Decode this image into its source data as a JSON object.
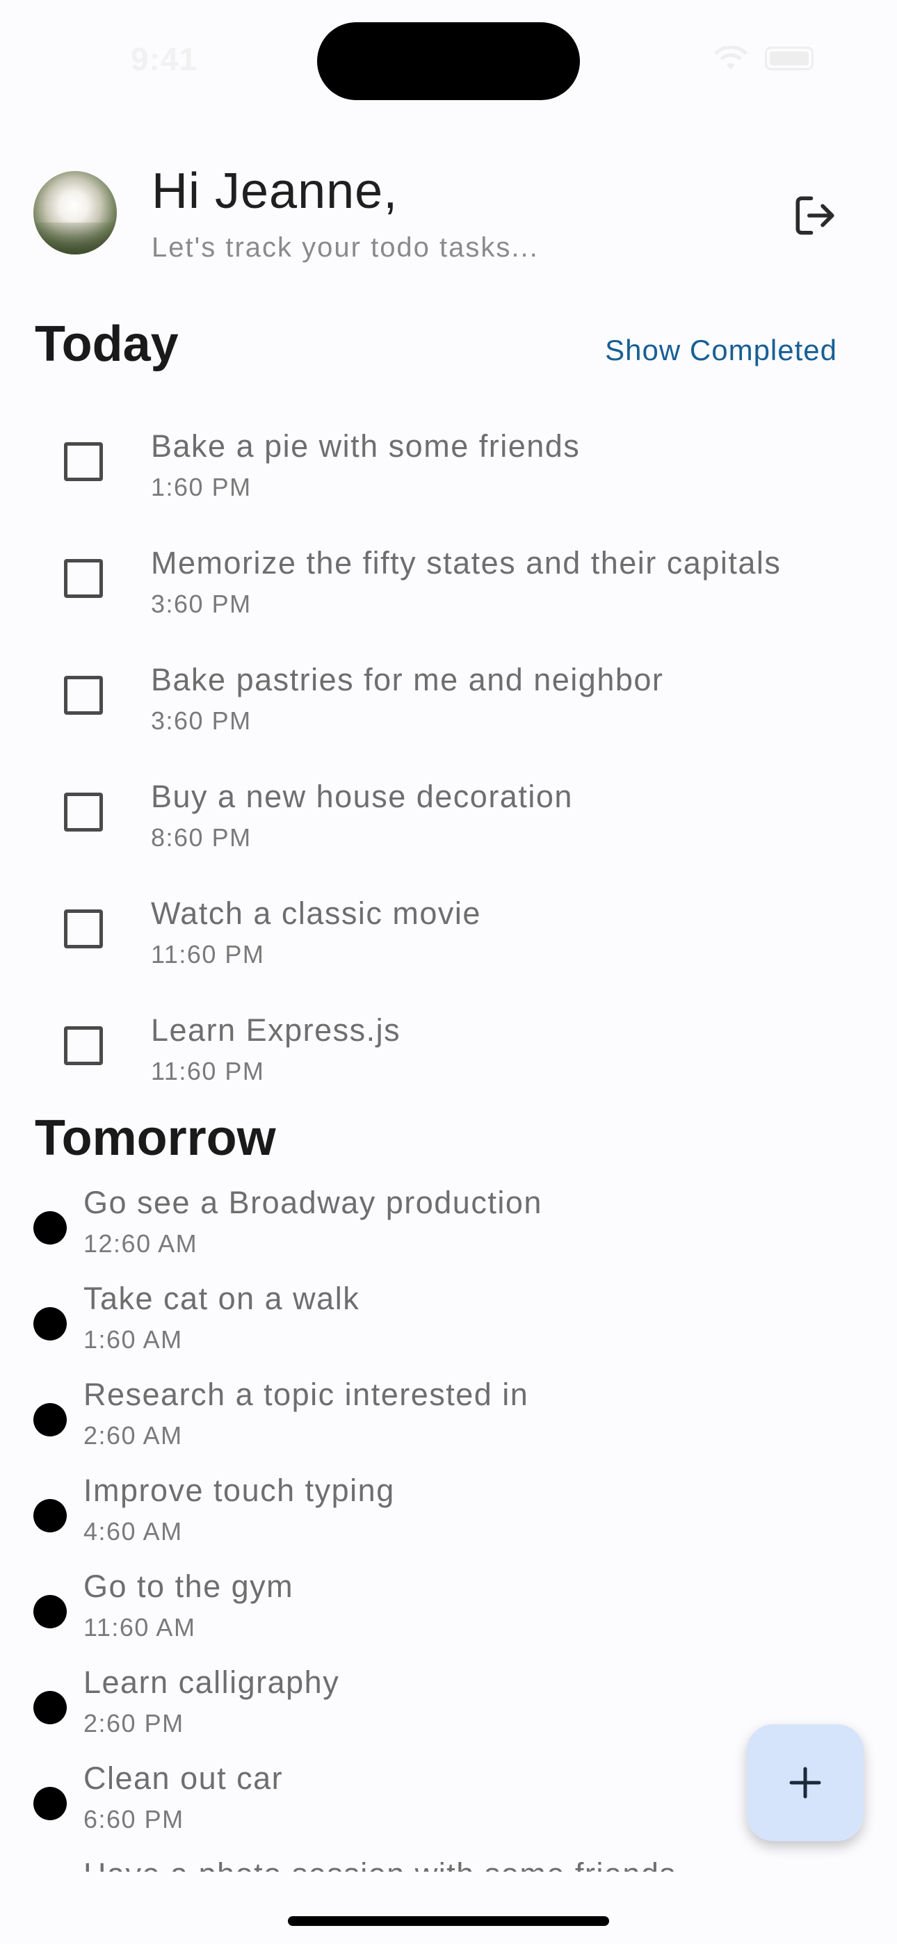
{
  "status_bar": {
    "time": "9:41"
  },
  "header": {
    "greeting": "Hi Jeanne,",
    "subtitle": "Let's track your todo tasks..."
  },
  "today": {
    "title": "Today",
    "show_completed_label": "Show Completed",
    "items": [
      {
        "title": "Bake a pie with some friends",
        "time": "1:60 PM",
        "checked": false
      },
      {
        "title": "Memorize the fifty states and their capitals",
        "time": "3:60 PM",
        "checked": false
      },
      {
        "title": "Bake pastries for me and neighbor",
        "time": "3:60 PM",
        "checked": false
      },
      {
        "title": "Buy a new house decoration",
        "time": "8:60 PM",
        "checked": false
      },
      {
        "title": "Watch a classic movie",
        "time": "11:60 PM",
        "checked": false
      },
      {
        "title": "Learn Express.js",
        "time": "11:60 PM",
        "checked": false
      }
    ]
  },
  "tomorrow": {
    "title": "Tomorrow",
    "items": [
      {
        "title": "Go see a Broadway production",
        "time": "12:60 AM"
      },
      {
        "title": "Take cat on a walk",
        "time": "1:60 AM"
      },
      {
        "title": "Research a topic interested in",
        "time": "2:60 AM"
      },
      {
        "title": "Improve touch typing",
        "time": "4:60 AM"
      },
      {
        "title": "Go to the gym",
        "time": "11:60 AM"
      },
      {
        "title": "Learn calligraphy",
        "time": "2:60 PM"
      },
      {
        "title": "Clean out car",
        "time": "6:60 PM"
      },
      {
        "title": "Have a photo session with some friends",
        "time": ""
      }
    ]
  },
  "icons": {
    "logout": "logout-icon",
    "add": "plus-icon",
    "wifi": "wifi-icon",
    "battery": "battery-icon"
  },
  "colors": {
    "accent": "#185f95",
    "fab_background": "#d6e4fb",
    "background": "#fcfbfe"
  }
}
